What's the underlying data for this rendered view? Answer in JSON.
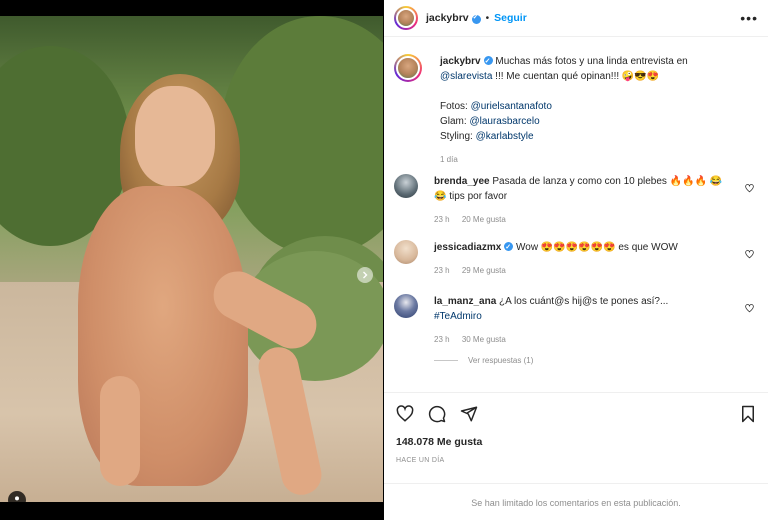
{
  "post": {
    "username": "jackybrv",
    "follow_label": "Seguir",
    "separator": "•",
    "more_label": "•••"
  },
  "caption": {
    "username": "jackybrv",
    "line1": "Muchas más fotos y una linda entrevista en",
    "mention": "@slarevista",
    "line1_rest": " !!! Me cuentan qué opinan!!! 🤪😎😍",
    "credits": [
      {
        "label": "Fotos: ",
        "handle": "@urielsantanafoto"
      },
      {
        "label": "Glam: ",
        "handle": "@laurasbarcelo"
      },
      {
        "label": "Styling: ",
        "handle": "@karlabstyle"
      }
    ],
    "time": "1 día"
  },
  "comments": [
    {
      "username": "brenda_yee",
      "text": " Pasada de lanza y como con 10 plebes 🔥🔥🔥 😂😂 tips por favor",
      "time": "23 h",
      "likes": "20 Me gusta",
      "verified": false,
      "avatar_color": "#5b6a73"
    },
    {
      "username": "jessicadiazmx",
      "text": " Wow 😍😍😍😍😍😍 es que WOW",
      "time": "23 h",
      "likes": "29 Me gusta",
      "verified": true,
      "avatar_color": "#d7b79a"
    },
    {
      "username": "la_manz_ana",
      "text": " ¿A los cuánt@s hij@s te pones así?...",
      "hashtag": "#TeAdmiro",
      "time": "23 h",
      "likes": "30 Me gusta",
      "verified": false,
      "avatar_color": "#2c3e6e"
    }
  ],
  "view_replies": "Ver respuestas (1)",
  "likes_total": "148.078 Me gusta",
  "posted_ago": "HACE UN DÍA",
  "comments_limited": "Se han limitado los comentarios en esta publicación."
}
